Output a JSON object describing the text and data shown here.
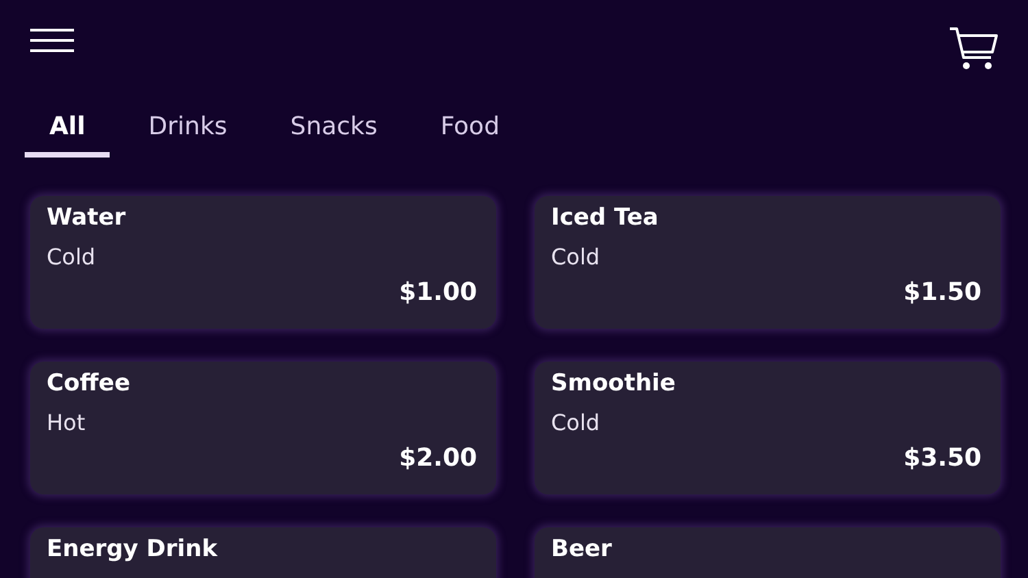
{
  "tabs": [
    {
      "label": "All",
      "selected": true
    },
    {
      "label": "Drinks",
      "selected": false
    },
    {
      "label": "Snacks",
      "selected": false
    },
    {
      "label": "Food",
      "selected": false
    }
  ],
  "items": [
    {
      "name": "Water",
      "note": "Cold",
      "price": "$1.00"
    },
    {
      "name": "Iced Tea",
      "note": "Cold",
      "price": "$1.50"
    },
    {
      "name": "Coffee",
      "note": "Hot",
      "price": "$2.00"
    },
    {
      "name": "Smoothie",
      "note": "Cold",
      "price": "$3.50"
    },
    {
      "name": "Energy Drink"
    },
    {
      "name": "Beer"
    }
  ]
}
